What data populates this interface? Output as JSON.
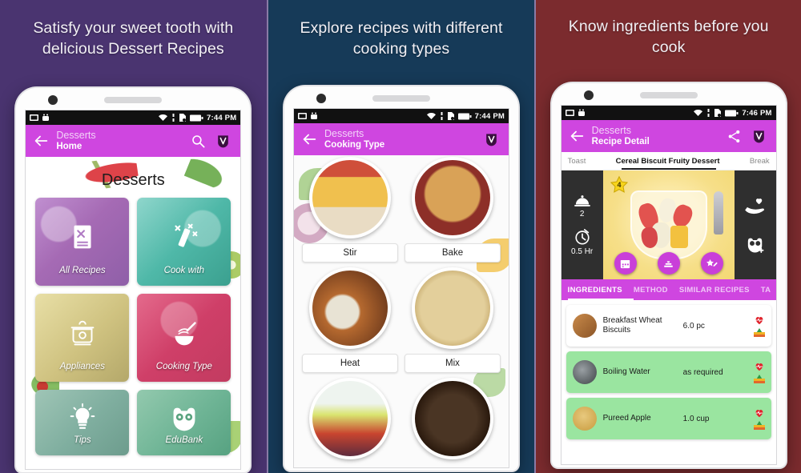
{
  "panels": [
    {
      "background": "#4a3470",
      "headline": "Satisfy your sweet tooth with delicious Dessert Recipes",
      "statusbar": {
        "time": "7:44 PM"
      },
      "appbar": {
        "app": "Desserts",
        "screen": "Home"
      },
      "page_title": "Desserts",
      "tiles": [
        {
          "label": "All Recipes",
          "icon": "recipe-book-icon"
        },
        {
          "label": "Cook with",
          "icon": "magic-wand-icon"
        },
        {
          "label": "Appliances",
          "icon": "appliance-icon"
        },
        {
          "label": "Cooking Type",
          "icon": "whisk-bowl-icon"
        },
        {
          "label": "Tips",
          "icon": "lightbulb-icon"
        },
        {
          "label": "EduBank",
          "icon": "owl-icon"
        }
      ]
    },
    {
      "background": "#163a58",
      "headline": "Explore recipes with different cooking types",
      "statusbar": {
        "time": "7:44 PM"
      },
      "appbar": {
        "app": "Desserts",
        "screen": "Cooking Type"
      },
      "types": [
        {
          "label": "Stir"
        },
        {
          "label": "Bake"
        },
        {
          "label": "Heat"
        },
        {
          "label": "Mix"
        },
        {
          "label": ""
        },
        {
          "label": ""
        }
      ]
    },
    {
      "background": "#7b2b2e",
      "headline": "Know ingredients before you cook",
      "statusbar": {
        "time": "7:46 PM"
      },
      "appbar": {
        "app": "Desserts",
        "screen": "Recipe Detail"
      },
      "recipe_nav": {
        "prev": "Toast",
        "current": "Cereal Biscuit Fruity Dessert",
        "next": "Break"
      },
      "hero": {
        "rating": "4",
        "servings": "2",
        "duration": "0.5 Hr"
      },
      "tabs": [
        {
          "label": "INGREDIENTS",
          "active": true
        },
        {
          "label": "METHOD",
          "active": false
        },
        {
          "label": "SIMILAR RECIPES",
          "active": false
        },
        {
          "label": "TA",
          "active": false
        }
      ],
      "ingredients": [
        {
          "name": "Breakfast Wheat Biscuits",
          "qty": "6.0 pc",
          "highlight": false
        },
        {
          "name": "Boiling Water",
          "qty": "as required",
          "highlight": true
        },
        {
          "name": "Pureed Apple",
          "qty": "1.0 cup",
          "highlight": true
        }
      ]
    }
  ],
  "colors": {
    "appbar": "#cf46e0",
    "tab_active": "#ffffff",
    "ingredient_highlight": "#9ae5a0",
    "fab": "#c93fd9"
  }
}
